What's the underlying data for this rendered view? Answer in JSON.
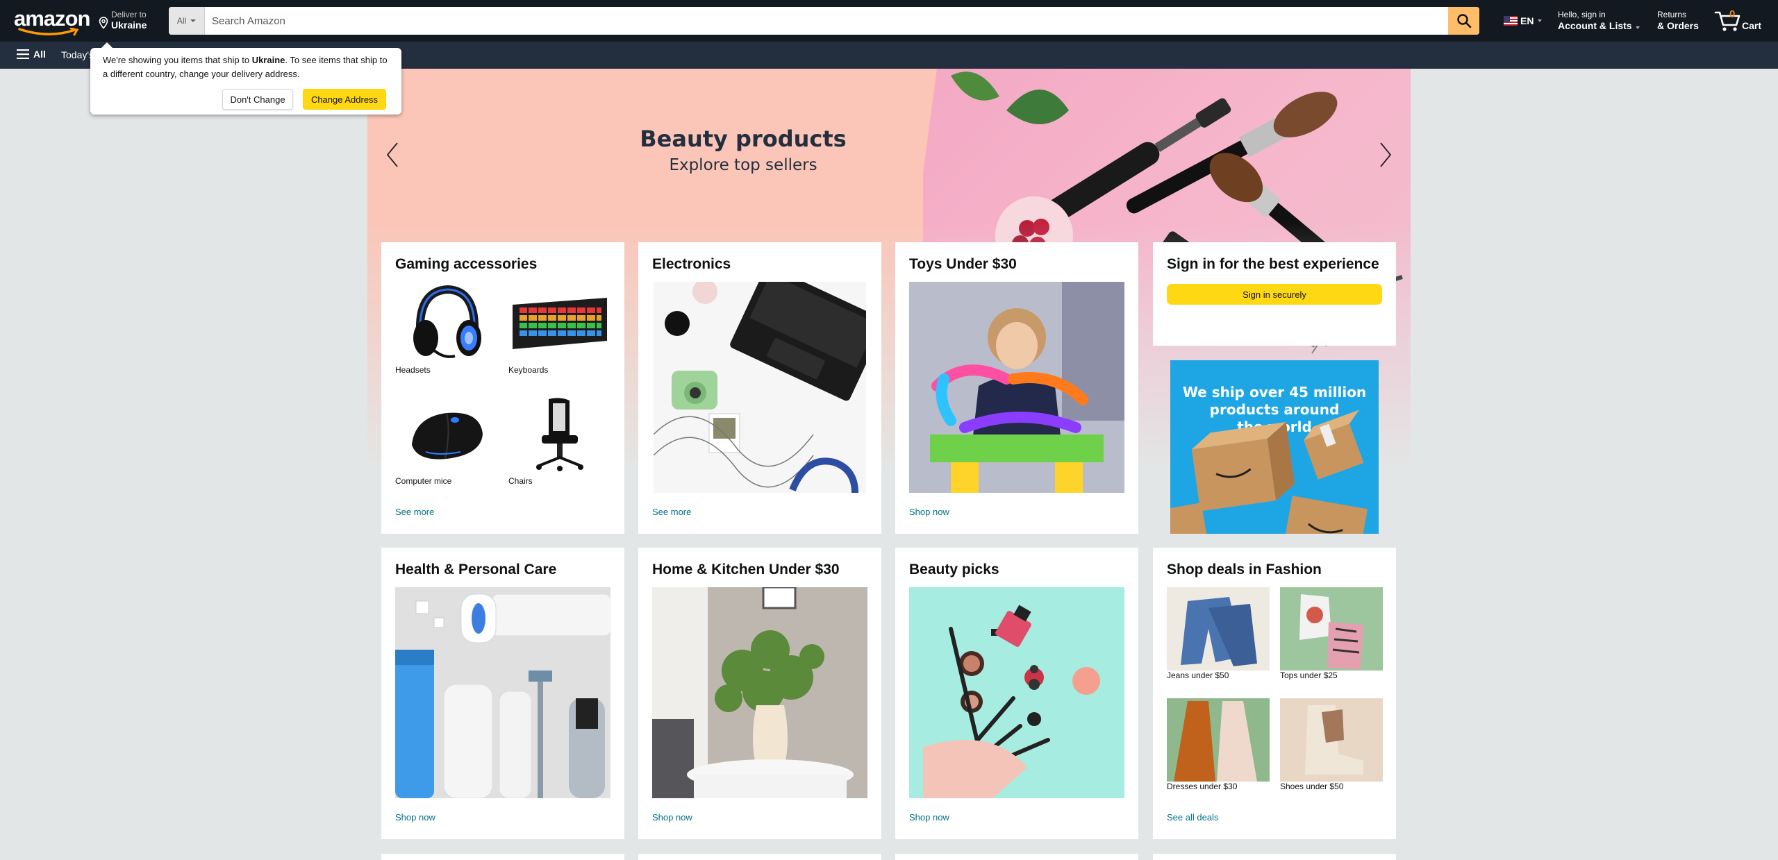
{
  "header": {
    "logo_text": "amazon",
    "deliver_label": "Deliver to",
    "deliver_country": "Ukraine",
    "search_category": "All",
    "search_placeholder": "Search Amazon",
    "language": "EN",
    "account_line1": "Hello, sign in",
    "account_line2": "Account & Lists",
    "returns_line1": "Returns",
    "returns_line2": "& Orders",
    "cart_count": "0",
    "cart_label": "Cart",
    "colors": {
      "nav": "#131921",
      "subnav": "#232f3e",
      "search_button": "#febd69",
      "cart_count": "#f08804"
    }
  },
  "subnav": {
    "all_label": "All",
    "today_label": "Today's Deals"
  },
  "popover": {
    "text_before": "We're showing you items that ship to ",
    "country": "Ukraine",
    "text_after": ". To see items that ship to a different country, change your delivery address.",
    "dont_change": "Don't Change",
    "change_address": "Change Address"
  },
  "hero": {
    "title": "Beauty products",
    "subtitle": "Explore top sellers"
  },
  "cards_row1": [
    {
      "title": "Gaming accessories",
      "items": [
        {
          "label": "Headsets",
          "icon": "headset-icon"
        },
        {
          "label": "Keyboards",
          "icon": "keyboard-icon"
        },
        {
          "label": "Computer mice",
          "icon": "mouse-icon"
        },
        {
          "label": "Chairs",
          "icon": "chair-icon"
        }
      ],
      "link": "See more"
    },
    {
      "title": "Electronics",
      "link": "See more"
    },
    {
      "title": "Toys Under $30",
      "link": "Shop now"
    }
  ],
  "signin_card": {
    "title": "Sign in for the best experience",
    "button": "Sign in securely"
  },
  "ship_banner": {
    "line1": "We ship over 45 million",
    "line2": "products around",
    "line3": "the world"
  },
  "cards_row2": [
    {
      "title": "Health & Personal Care",
      "link": "Shop now"
    },
    {
      "title": "Home & Kitchen Under $30",
      "link": "Shop now"
    },
    {
      "title": "Beauty picks",
      "link": "Shop now"
    },
    {
      "title": "Shop deals in Fashion",
      "items": [
        {
          "label": "Jeans under $50"
        },
        {
          "label": "Tops under $25"
        },
        {
          "label": "Dresses under $30"
        },
        {
          "label": "Shoes under $50"
        }
      ],
      "link": "See all deals"
    }
  ]
}
